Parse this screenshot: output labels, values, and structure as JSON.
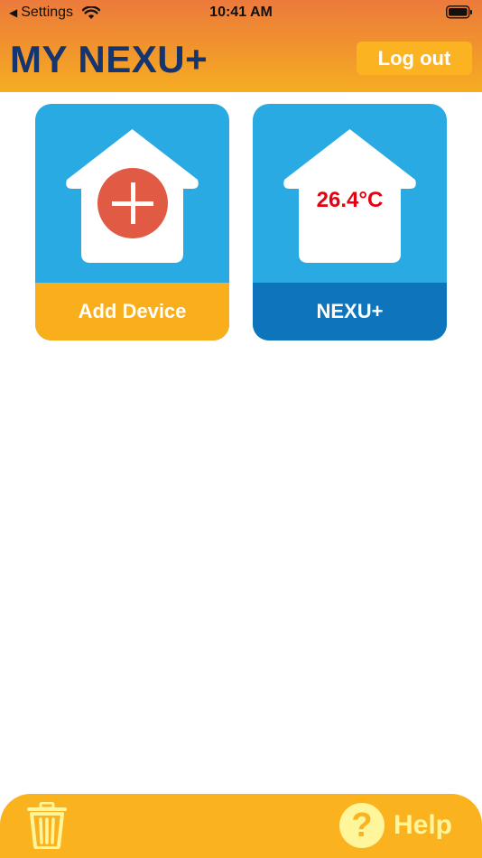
{
  "statusbar": {
    "back_label": "Settings",
    "time": "10:41 AM",
    "icons": [
      "back-arrow-icon",
      "wifi-icon",
      "battery-icon"
    ]
  },
  "header": {
    "title": "MY NEXU+",
    "logout_label": "Log out"
  },
  "tiles": [
    {
      "label": "Add Device",
      "icon": "add-circle-icon"
    },
    {
      "label": "NEXU+",
      "temperature": "26.4°C",
      "icon": "house-icon"
    }
  ],
  "bottombar": {
    "trash_icon": "trash-icon",
    "help_icon": "question-icon",
    "help_glyph": "?",
    "help_label": "Help"
  },
  "colors": {
    "header_top": "#ec7a3c",
    "header_bottom": "#f6ad22",
    "title": "#16356e",
    "tile_blue": "#29aae2",
    "tile_footer_add": "#f9ae1c",
    "tile_footer_device": "#0e74bb",
    "plus_red": "#e05a44",
    "temp_red": "#e60012",
    "bottom_bar": "#fbb21f",
    "help_yellow": "#fff59b"
  }
}
